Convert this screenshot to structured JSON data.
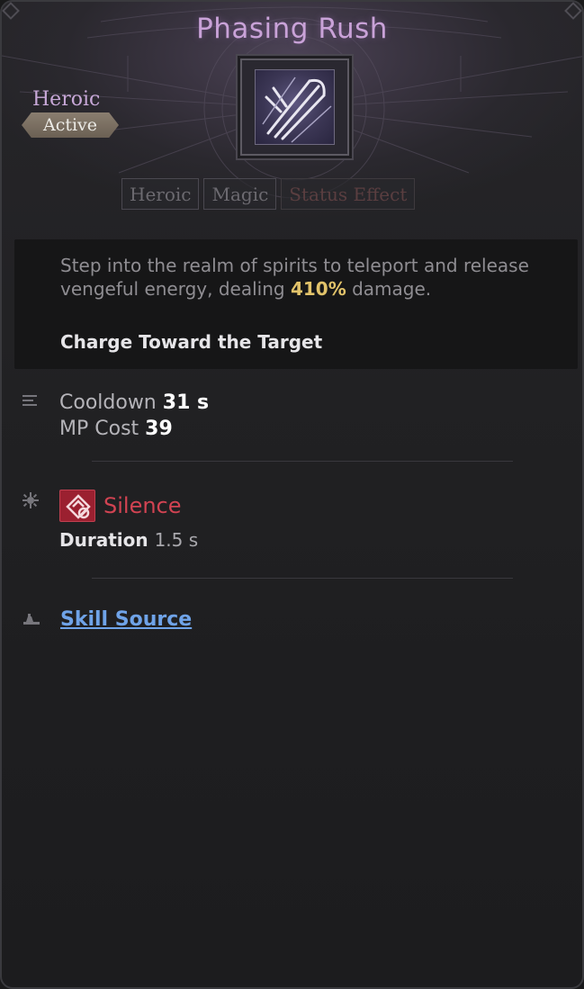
{
  "skill": {
    "title": "Phasing Rush",
    "grade": "Heroic",
    "type": "Active",
    "icon": "claw-slash-icon"
  },
  "tags": [
    {
      "label": "Heroic",
      "state": "normal"
    },
    {
      "label": "Magic",
      "state": "normal"
    },
    {
      "label": "Status Effect",
      "state": "dim"
    }
  ],
  "description": {
    "text_before": "Step into the realm of spirits to teleport and release vengeful energy, dealing ",
    "damage": "410%",
    "text_after": " damage.",
    "subline": "Charge Toward the Target"
  },
  "stats": {
    "cooldown_label": "Cooldown",
    "cooldown_value": "31 s",
    "mp_label": "MP Cost",
    "mp_value": "39"
  },
  "effect": {
    "name": "Silence",
    "duration_label": "Duration",
    "duration_value": "1.5 s",
    "icon": "silence-icon"
  },
  "source": {
    "label": "Skill Source"
  },
  "colors": {
    "title": "#c9a2d8",
    "damage_highlight": "#e2c36a",
    "effect": "#d14352",
    "link": "#6fa3e8"
  }
}
